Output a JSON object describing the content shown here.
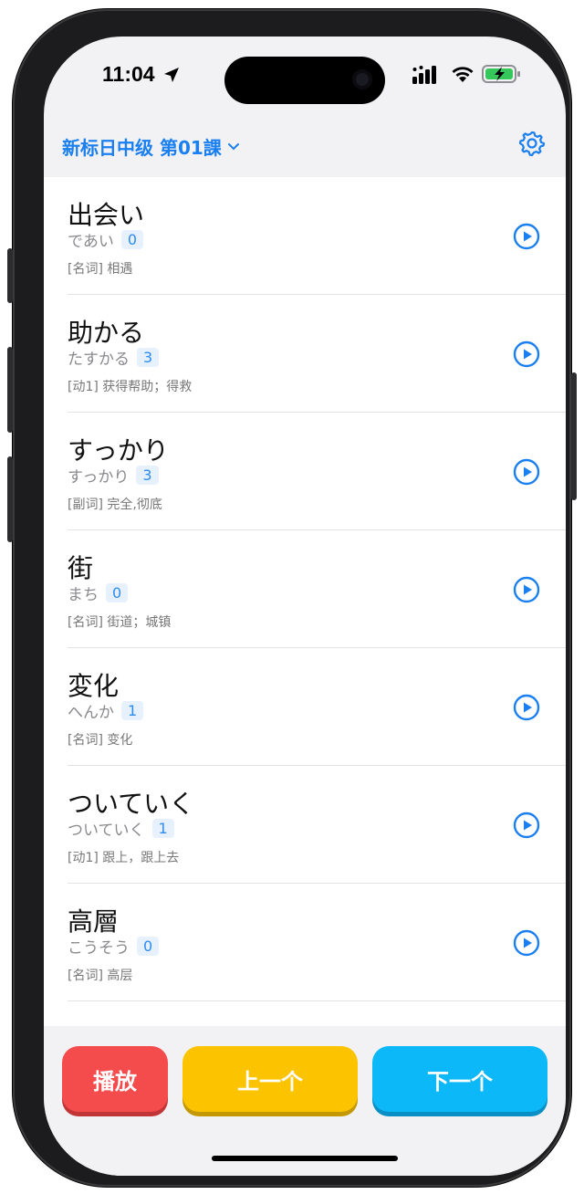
{
  "status_bar": {
    "time": "11:04"
  },
  "header": {
    "lesson_title": "新标日中级 第01課"
  },
  "colors": {
    "accent": "#1a7ff0",
    "play_button": "#f44c4d",
    "prev_button": "#fcc400",
    "next_button": "#0cb8f7"
  },
  "words": [
    {
      "word": "出会い",
      "reading": "であい",
      "count": "0",
      "meaning": "[名词] 相遇"
    },
    {
      "word": "助かる",
      "reading": "たすかる",
      "count": "3",
      "meaning": "[动1] 获得帮助；得救"
    },
    {
      "word": "すっかり",
      "reading": "すっかり",
      "count": "3",
      "meaning": "[副词] 完全,彻底"
    },
    {
      "word": "街",
      "reading": "まち",
      "count": "0",
      "meaning": "[名词] 街道；城镇"
    },
    {
      "word": "変化",
      "reading": "へんか",
      "count": "1",
      "meaning": "[名词] 变化"
    },
    {
      "word": "ついていく",
      "reading": "ついていく",
      "count": "1",
      "meaning": "[动1] 跟上，跟上去"
    },
    {
      "word": "高層",
      "reading": "こうそう",
      "count": "0",
      "meaning": "[名词] 高层"
    },
    {
      "word": "高層",
      "reading": "",
      "count": "",
      "meaning": ""
    }
  ],
  "buttons": {
    "play": "播放",
    "prev": "上一个",
    "next": "下一个"
  },
  "icons": {
    "play_item": "play-circle-icon",
    "settings": "gear-icon",
    "dropdown": "chevron-down-icon"
  }
}
